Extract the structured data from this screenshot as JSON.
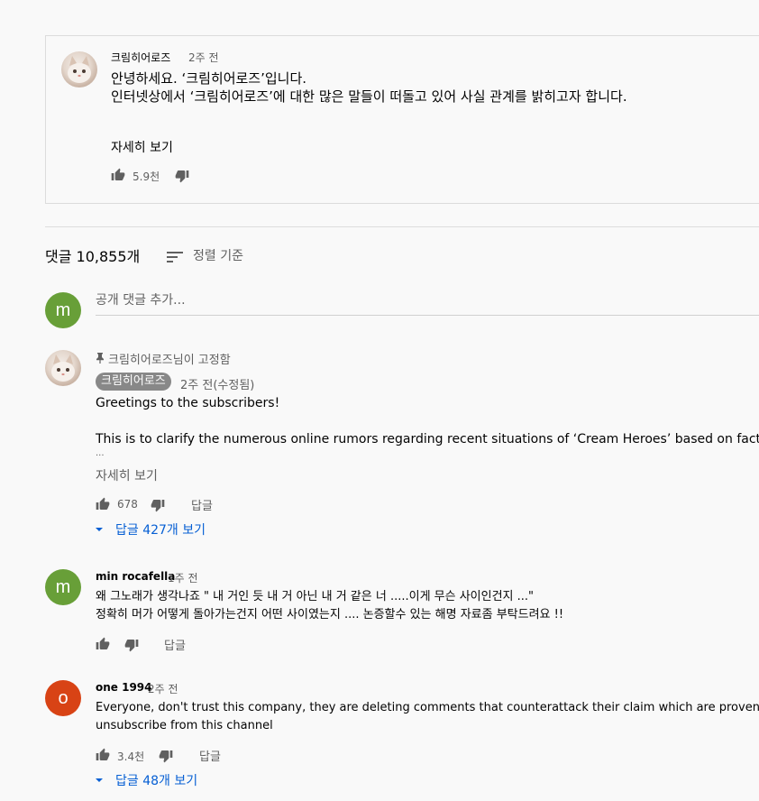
{
  "post": {
    "author": "크림히어로즈",
    "time": "2주 전",
    "line1": "안녕하세요. ‘크림히어로즈’입니다.",
    "line2": "인터넷상에서 ‘크림히어로즈’에 대한 많은 말들이 떠돌고 있어 사실 관계를 밝히고자 합니다.",
    "read_more": "자세히 보기",
    "likes": "5.9천"
  },
  "comments_header": {
    "count": "댓글 10,855개",
    "sort_label": "정렬 기준"
  },
  "composer": {
    "avatar_letter": "m",
    "placeholder": "공개 댓글 추가..."
  },
  "comments": [
    {
      "pinned": "크림히어로즈님이 고정함",
      "author": "크림히어로즈",
      "time": "2주 전(수정됨)",
      "line1": "Greetings to the subscribers!",
      "line2": "This is to clarify the numerous online rumors regarding recent situations of ‘Cream Heroes’ based on facts.",
      "ellipsis": "...",
      "read_more": "자세히 보기",
      "likes": "678",
      "reply": "답글",
      "view_replies": "답글 427개 보기"
    },
    {
      "avatar_letter": "m",
      "author": "min rocafella",
      "time": "1주 전",
      "line1": "왜 그노래가 생각나죠 \" 내 거인 듯 내 거 아닌 내 거 같은 너 .....이게 무슨 사이인건지 ...\"",
      "line2": "정확히 머가 어떻게 돌아가는건지 어떤 사이였는지 .... 논증할수 있는 해명 자료좀 부탁드려요 !!",
      "reply": "답글"
    },
    {
      "avatar_letter": "o",
      "author": "one 1994",
      "time": "2주 전",
      "line1": "Everyone, don't trust this company, they are deleting comments that counterattack their claim which are proven false. Just",
      "line2": "unsubscribe from this channel",
      "likes": "3.4천",
      "reply": "답글",
      "view_replies": "답글 48개 보기"
    }
  ],
  "colors": {
    "avatar_green": "#689f38",
    "avatar_orange": "#d84315",
    "link_blue": "#065fd4",
    "chip_gray": "#888888"
  }
}
